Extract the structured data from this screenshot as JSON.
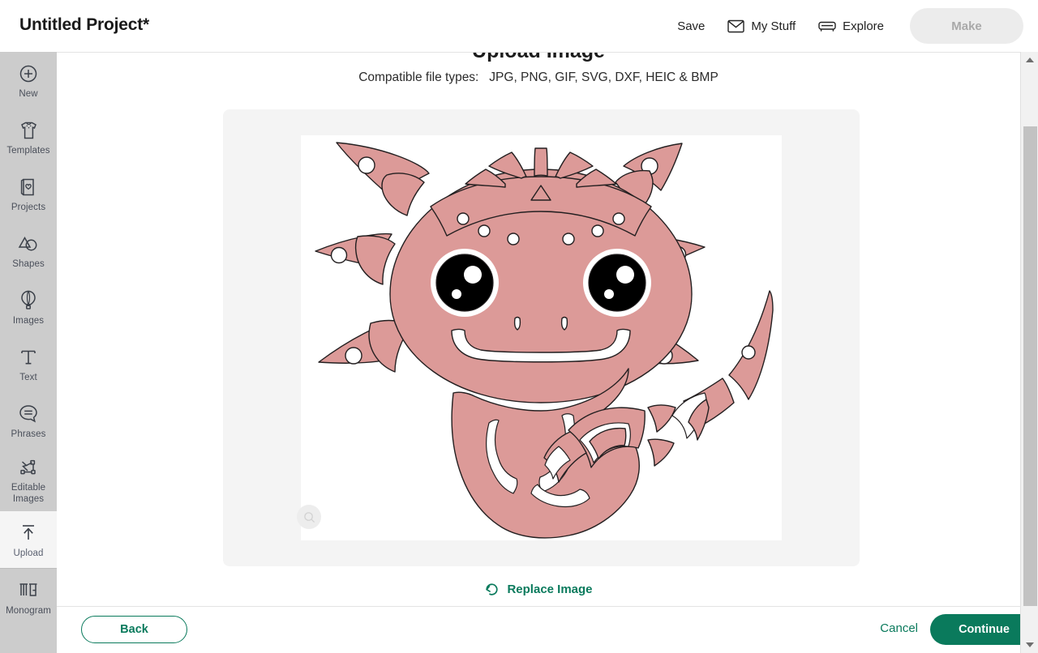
{
  "app": {
    "project_title": "Untitled Project*",
    "accent_green": "#0a7a5c",
    "sidebar_bg": "#cccccc",
    "frame_bg": "#f4f4f4"
  },
  "topbar": {
    "save_label": "Save",
    "my_stuff_label": "My Stuff",
    "explore_label": "Explore",
    "make_label": "Make"
  },
  "sidebar": {
    "items": [
      {
        "label": "New",
        "icon": "plus-circle-icon",
        "active": false
      },
      {
        "label": "Templates",
        "icon": "tshirt-icon",
        "active": false
      },
      {
        "label": "Projects",
        "icon": "card-heart-icon",
        "active": false
      },
      {
        "label": "Shapes",
        "icon": "shapes-icon",
        "active": false
      },
      {
        "label": "Images",
        "icon": "hot-air-balloon-icon",
        "active": false
      },
      {
        "label": "Text",
        "icon": "text-t-icon",
        "active": false
      },
      {
        "label": "Phrases",
        "icon": "speech-bubble-icon",
        "active": false
      },
      {
        "label": "Editable\nImages",
        "icon": "node-path-icon",
        "active": false
      },
      {
        "label": "Upload",
        "icon": "upload-arrow-icon",
        "active": true
      },
      {
        "label": "Monogram",
        "icon": "monogram-mg-icon",
        "active": false
      }
    ]
  },
  "main": {
    "title": "Upload Image",
    "subtitle_lead": "Compatible file types:",
    "subtitle_types": "JPG, PNG, GIF, SVG, DXF, HEIC & BMP",
    "replace_image_label": "Replace Image"
  },
  "artwork": {
    "name": "axolotl-papercut-illustration",
    "fill_color": "#dc9a98",
    "stroke_color": "#231f20",
    "eye_color": "#000000",
    "background": "#ffffff"
  },
  "bottombar": {
    "back_label": "Back",
    "cancel_label": "Cancel",
    "continue_label": "Continue"
  }
}
